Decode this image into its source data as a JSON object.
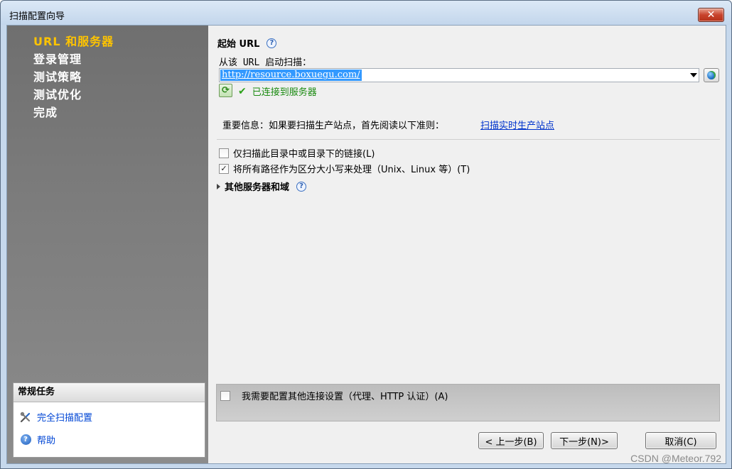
{
  "window": {
    "title": "扫描配置向导",
    "close_glyph": "✕"
  },
  "sidebar": {
    "steps": [
      {
        "label": "URL 和服务器",
        "active": true
      },
      {
        "label": "登录管理",
        "active": false
      },
      {
        "label": "测试策略",
        "active": false
      },
      {
        "label": "测试优化",
        "active": false
      },
      {
        "label": "完成",
        "active": false
      }
    ],
    "tasks": {
      "header": "常规任务",
      "items": [
        {
          "label": "完全扫描配置",
          "icon": "tools-icon"
        },
        {
          "label": "帮助",
          "icon": "help-icon"
        }
      ]
    }
  },
  "main": {
    "section_title": "起始 URL",
    "help_glyph": "?",
    "start_label": "从该 URL 启动扫描：",
    "url_value": "http://resource.boxuegu.com/",
    "connection_status": "已连接到服务器",
    "important_text": "重要信息：如果要扫描生产站点，首先阅读以下准则：",
    "important_link": "扫描实时生产站点",
    "options": [
      {
        "label": "仅扫描此目录中或目录下的链接(L)",
        "checked": false
      },
      {
        "label": "将所有路径作为区分大小写来处理（Unix、Linux 等）(T)",
        "checked": true
      }
    ],
    "other_servers": "其他服务器和域",
    "extra_connection": {
      "label": "我需要配置其他连接设置（代理、HTTP 认证）(A)",
      "checked": false
    }
  },
  "buttons": {
    "back": "< 上一步(B)",
    "next": "下一步(N)>",
    "cancel": "取消(C)"
  },
  "watermark": "CSDN @Meteor.792",
  "colors": {
    "active_step": "#ffc400",
    "link": "#0033cc",
    "connected": "#1a8a10",
    "sidebar": "#7c7c7c"
  }
}
